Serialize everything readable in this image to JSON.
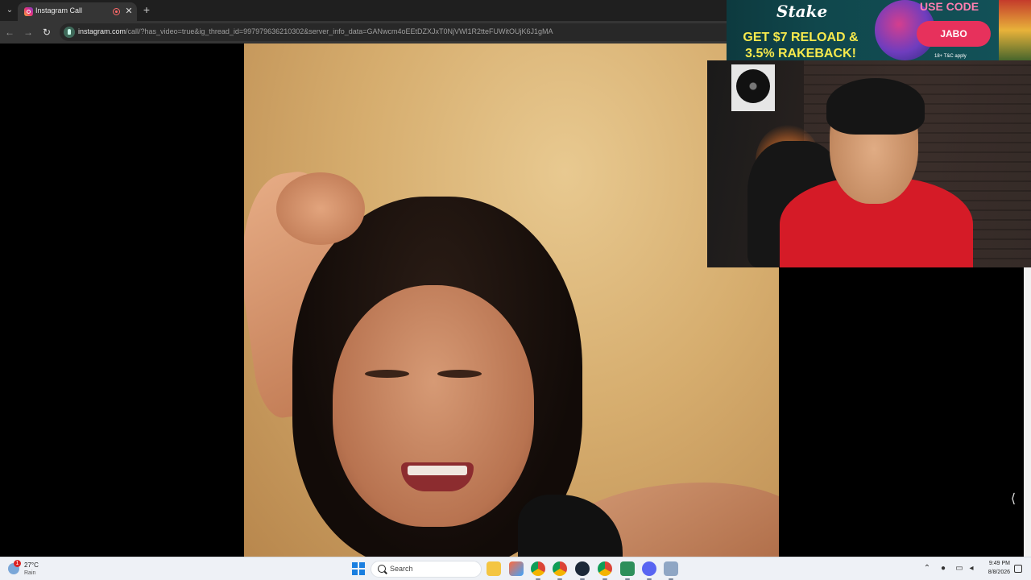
{
  "browser": {
    "tab_title": "Instagram Call",
    "close_glyph": "✕",
    "new_tab_glyph": "+",
    "tab_list_glyph": "⌄",
    "url_host": "instagram.com",
    "url_path": "/call/?has_video=true&ig_thread_id=997979636210302&server_info_data=GANwcm4oEEtDZXJxT0NjVWl1R2tteFUWitOUjK6J1gMA",
    "back_glyph": "←",
    "forward_glyph": "→",
    "reload_glyph": "↻",
    "icons": [
      "instagram-icon",
      "recording-icon",
      "close-icon",
      "plus-icon",
      "back-arrow-icon",
      "forward-arrow-icon",
      "reload-icon",
      "site-info-icon"
    ]
  },
  "ad": {
    "brand": "Stake",
    "headline_1": "GET $7 RELOAD &",
    "headline_2": "3.5% RAKEBACK!",
    "use_code": "USE CODE",
    "code": "JABO",
    "terms": "18+ T&C apply",
    "colors": {
      "headline": "#f7e94c",
      "code_button": "#e7315c",
      "use_code": "#ff7fb0"
    }
  },
  "content": {
    "sidebar_toggle_glyph": "⟨"
  },
  "taskbar": {
    "weather_temp": "27°C",
    "weather_cond": "Rain",
    "weather_badge": "1",
    "search_label": "Search",
    "apps": [
      "file-explorer-icon",
      "photos-icon",
      "chrome-icon",
      "chrome-icon",
      "steam-icon",
      "chrome-icon",
      "app-icon",
      "discord-icon",
      "snipping-icon"
    ],
    "clock_time": "9:49 PM",
    "clock_date": "8/8/2026",
    "tray_icons": [
      "chevron-up-icon",
      "microphone-icon",
      "network-icon",
      "volume-icon",
      "notification-icon"
    ]
  }
}
